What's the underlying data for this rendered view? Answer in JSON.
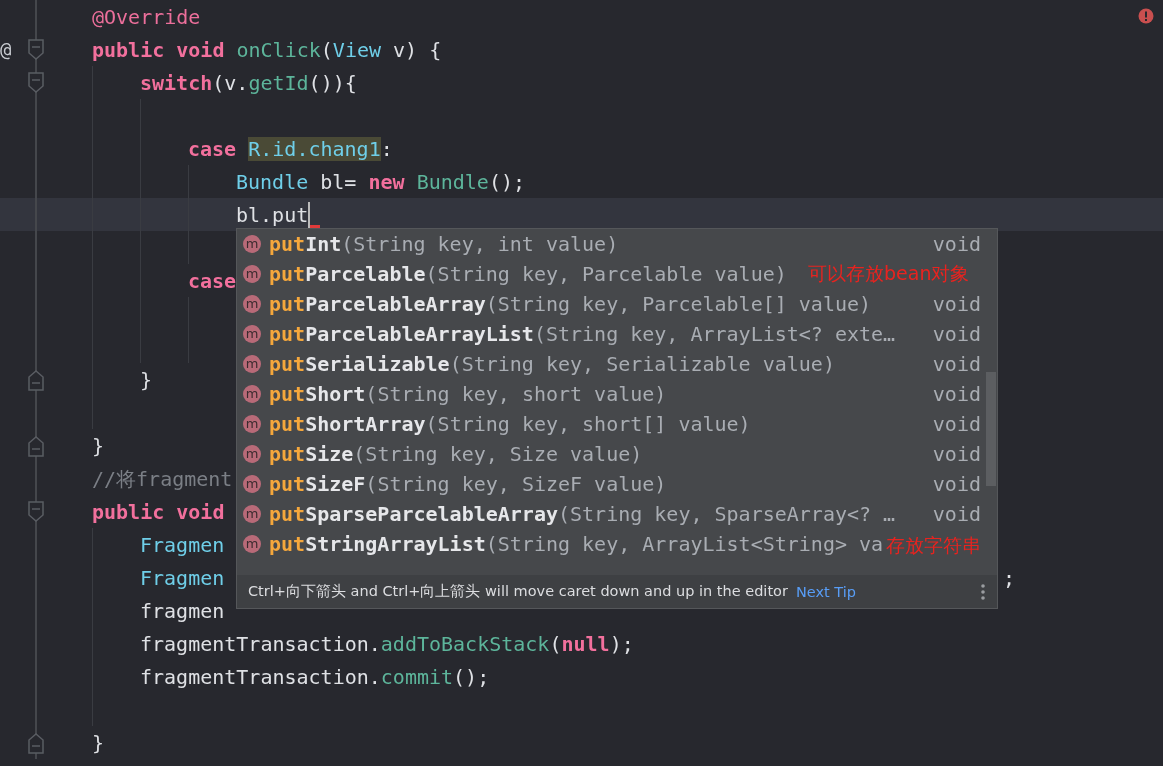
{
  "editor": {
    "lines": [
      {
        "current": false,
        "fold_start": false,
        "fold_end": false,
        "tokens": [
          {
            "kind": "annotation",
            "text": "@Override"
          }
        ]
      },
      {
        "current": false,
        "fold_start": true,
        "fold_end": false,
        "gutter_mark": "@",
        "tokens": [
          {
            "kind": "keyword",
            "text": "public void "
          },
          {
            "kind": "function",
            "text": "onClick"
          },
          {
            "kind": "plain",
            "text": "("
          },
          {
            "kind": "type",
            "text": "View"
          },
          {
            "kind": "plain",
            "text": " v) {"
          }
        ],
        "children": [
          {
            "current": false,
            "fold_start": true,
            "fold_end": false,
            "tokens": [
              {
                "kind": "keyword",
                "text": "switch"
              },
              {
                "kind": "plain",
                "text": "(v."
              },
              {
                "kind": "function",
                "text": "getId"
              },
              {
                "kind": "plain",
                "text": "()){"
              }
            ],
            "children": [
              {
                "current": false,
                "fold_start": false,
                "fold_end": false
              },
              {
                "current": false,
                "fold_start": false,
                "fold_end": false,
                "tokens": [
                  {
                    "kind": "keyword",
                    "text": "case "
                  },
                  {
                    "kind": "match",
                    "text": "R.id.chang1"
                  },
                  {
                    "kind": "plain",
                    "text": ":"
                  }
                ],
                "children": [
                  {
                    "current": false,
                    "fold_start": false,
                    "fold_end": false,
                    "tokens": [
                      {
                        "kind": "type",
                        "text": "Bundle"
                      },
                      {
                        "kind": "plain",
                        "text": " bl= "
                      },
                      {
                        "kind": "keyword",
                        "text": "new "
                      },
                      {
                        "kind": "function",
                        "text": "Bundle"
                      },
                      {
                        "kind": "plain",
                        "text": "();"
                      }
                    ]
                  },
                  {
                    "current": true,
                    "caret": true,
                    "fold_start": false,
                    "fold_end": false,
                    "tokens": [
                      {
                        "kind": "plain",
                        "text": "bl.put"
                      }
                    ]
                  },
                  {
                    "current": false,
                    "fold_start": false,
                    "fold_end": false
                  }
                ]
              },
              {
                "current": false,
                "fold_start": false,
                "fold_end": false,
                "tokens": [
                  {
                    "kind": "keyword",
                    "text": "case"
                  }
                ],
                "children": [
                  {
                    "current": false,
                    "fold_start": false,
                    "fold_end": false
                  },
                  {
                    "current": false,
                    "fold_start": false,
                    "fold_end": false
                  }
                ]
              }
            ]
          },
          {
            "current": false,
            "fold_start": false,
            "fold_end": true,
            "tokens": [
              {
                "kind": "plain",
                "text": "}"
              }
            ]
          },
          {
            "current": false,
            "fold_start": false,
            "fold_end": false
          }
        ]
      },
      {
        "current": false,
        "fold_start": false,
        "fold_end": true,
        "tokens": [
          {
            "kind": "plain",
            "text": "}"
          }
        ]
      },
      {
        "current": false,
        "fold_start": false,
        "fold_end": false,
        "tokens": [
          {
            "kind": "comment",
            "text": "//将fragment"
          }
        ]
      },
      {
        "current": false,
        "fold_start": true,
        "fold_end": false,
        "tokens": [
          {
            "kind": "keyword",
            "text": "public void"
          }
        ],
        "children": [
          {
            "current": false,
            "fold_start": false,
            "fold_end": false,
            "tokens": [
              {
                "kind": "type",
                "text": "Fragmen"
              }
            ]
          },
          {
            "current": false,
            "fold_start": false,
            "fold_end": false,
            "tokens": [
              {
                "kind": "type",
                "text": "Fragmen"
              }
            ],
            "tail": [
              {
                "kind": "plain",
                "text": ";"
              }
            ]
          },
          {
            "current": false,
            "fold_start": false,
            "fold_end": false,
            "tokens": [
              {
                "kind": "plain",
                "text": "fragmen"
              }
            ]
          },
          {
            "current": false,
            "fold_start": false,
            "fold_end": false,
            "tokens": [
              {
                "kind": "plain",
                "text": "fragmentTransaction."
              },
              {
                "kind": "function",
                "text": "addToBackStack"
              },
              {
                "kind": "plain",
                "text": "("
              },
              {
                "kind": "keyword",
                "text": "null"
              },
              {
                "kind": "plain",
                "text": ");"
              }
            ]
          },
          {
            "current": false,
            "fold_start": false,
            "fold_end": false,
            "tokens": [
              {
                "kind": "plain",
                "text": "fragmentTransaction."
              },
              {
                "kind": "function",
                "text": "commit"
              },
              {
                "kind": "plain",
                "text": "();"
              }
            ]
          },
          {
            "current": false,
            "fold_start": false,
            "fold_end": false
          }
        ]
      },
      {
        "current": false,
        "fold_start": false,
        "fold_end": true,
        "tokens": [
          {
            "kind": "plain",
            "text": "}"
          }
        ]
      }
    ]
  },
  "completion": {
    "items": [
      {
        "icon": "m",
        "prefix": "put",
        "name": "Int",
        "params": "(String key, int value)",
        "returns": "void"
      },
      {
        "icon": "m",
        "prefix": "put",
        "name": "Parcelable",
        "params": "(String key, Parcelable value)"
      },
      {
        "icon": "m",
        "prefix": "put",
        "name": "ParcelableArray",
        "params": "(String key, Parcelable[] value)",
        "returns": "void"
      },
      {
        "icon": "m",
        "prefix": "put",
        "name": "ParcelableArrayList",
        "params": "(String key, ArrayList<? exte…",
        "returns": "void"
      },
      {
        "icon": "m",
        "prefix": "put",
        "name": "Serializable",
        "params": "(String key, Serializable value)",
        "returns": "void"
      },
      {
        "icon": "m",
        "prefix": "put",
        "name": "Short",
        "params": "(String key, short value)",
        "returns": "void"
      },
      {
        "icon": "m",
        "prefix": "put",
        "name": "ShortArray",
        "params": "(String key, short[] value)",
        "returns": "void"
      },
      {
        "icon": "m",
        "prefix": "put",
        "name": "Size",
        "params": "(String key, Size value)",
        "returns": "void"
      },
      {
        "icon": "m",
        "prefix": "put",
        "name": "SizeF",
        "params": "(String key, SizeF value)",
        "returns": "void"
      },
      {
        "icon": "m",
        "prefix": "put",
        "name": "SparseParcelableArray",
        "params": "(String key, SparseArray<? …",
        "returns": "void"
      },
      {
        "icon": "m",
        "prefix": "put",
        "name": "StringArrayList",
        "params": "(String key, ArrayList<String> va"
      }
    ],
    "footer": {
      "tip": "Ctrl+向下箭头 and Ctrl+向上箭头 will move caret down and up in the editor",
      "link": "Next Tip"
    }
  },
  "annotations": [
    {
      "text": "可以存放bean对象"
    },
    {
      "text": "存放字符串"
    }
  ]
}
